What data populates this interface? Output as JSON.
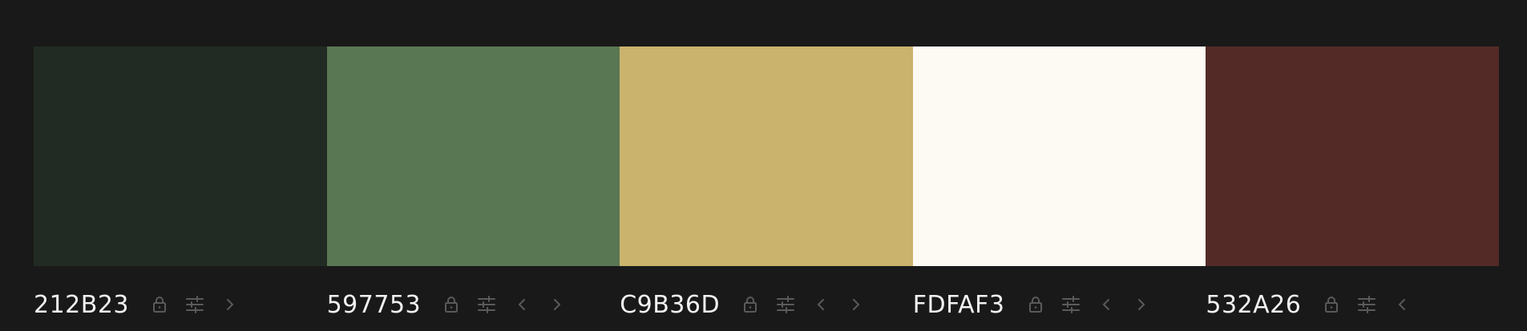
{
  "palette": [
    {
      "hex": "212B23",
      "color": "#212B23",
      "controls": [
        "lock-icon",
        "sliders-icon",
        "chevron-right-icon"
      ]
    },
    {
      "hex": "597753",
      "color": "#597753",
      "controls": [
        "lock-icon",
        "sliders-icon",
        "chevron-left-icon",
        "chevron-right-icon"
      ]
    },
    {
      "hex": "C9B36D",
      "color": "#C9B36D",
      "controls": [
        "lock-icon",
        "sliders-icon",
        "chevron-left-icon",
        "chevron-right-icon"
      ]
    },
    {
      "hex": "FDFAF3",
      "color": "#FDFAF3",
      "controls": [
        "lock-icon",
        "sliders-icon",
        "chevron-left-icon",
        "chevron-right-icon"
      ]
    },
    {
      "hex": "532A26",
      "color": "#532A26",
      "controls": [
        "lock-icon",
        "sliders-icon",
        "chevron-left-icon"
      ]
    }
  ],
  "colors": {
    "background": "#191919",
    "text": "#F2F2F2",
    "icon": "#5A5A5A"
  }
}
